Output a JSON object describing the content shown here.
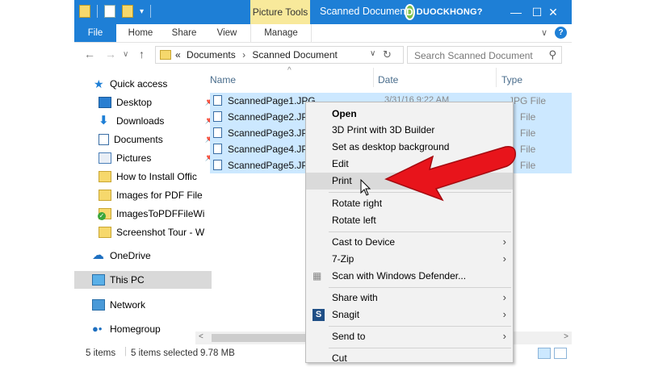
{
  "titlebar": {
    "picture_tools": "Picture Tools",
    "title": "Scanned Document",
    "logo_text": "DUOCKHONG?",
    "minimize": "—",
    "maximize": "☐",
    "close": "✕"
  },
  "ribbon": {
    "tabs": [
      "File",
      "Home",
      "Share",
      "View",
      "Manage"
    ]
  },
  "address": {
    "crumb_prefix": "«",
    "crumbs": [
      "Documents",
      "Scanned Document"
    ],
    "search_placeholder": "Search Scanned Document"
  },
  "nav": {
    "items": [
      {
        "label": "Quick access",
        "icon": "star-icon"
      },
      {
        "label": "Desktop",
        "icon": "desktop-icon"
      },
      {
        "label": "Downloads",
        "icon": "download-icon"
      },
      {
        "label": "Documents",
        "icon": "documents-icon"
      },
      {
        "label": "Pictures",
        "icon": "pictures-icon"
      },
      {
        "label": "How to Install Offic",
        "icon": "folder-icon"
      },
      {
        "label": "Images for PDF File",
        "icon": "folder-icon"
      },
      {
        "label": "ImagesToPDFFileWi",
        "icon": "folder-check-icon"
      },
      {
        "label": "Screenshot Tour - W",
        "icon": "folder-icon"
      },
      {
        "label": "OneDrive",
        "icon": "cloud-icon"
      },
      {
        "label": "This PC",
        "icon": "computer-icon"
      },
      {
        "label": "Network",
        "icon": "network-icon"
      },
      {
        "label": "Homegroup",
        "icon": "homegroup-icon"
      }
    ]
  },
  "columns": {
    "name": "Name",
    "date": "Date",
    "type": "Type"
  },
  "files": [
    {
      "name": "ScannedPage1.JPG",
      "date": "3/31/16 9:22 AM",
      "type": "JPG File"
    },
    {
      "name": "ScannedPage2.JPG",
      "type": "File"
    },
    {
      "name": "ScannedPage3.JPG",
      "type": "File"
    },
    {
      "name": "ScannedPage4.JPG",
      "type": "File"
    },
    {
      "name": "ScannedPage5.JPG",
      "type": "File"
    }
  ],
  "status": {
    "items": "5 items",
    "selected": "5 items selected",
    "size": "9.78 MB"
  },
  "context_menu": {
    "items": [
      "Open",
      "3D Print with 3D Builder",
      "Set as desktop background",
      "Edit",
      "Print",
      "Rotate right",
      "Rotate left",
      "Cast to Device",
      "7-Zip",
      "Scan with Windows Defender...",
      "Share with",
      "Snagit",
      "Send to",
      "Cut"
    ]
  },
  "colors": {
    "accent": "#1e7fd6",
    "selection": "#cce8ff",
    "arrow": "#e8141b"
  }
}
